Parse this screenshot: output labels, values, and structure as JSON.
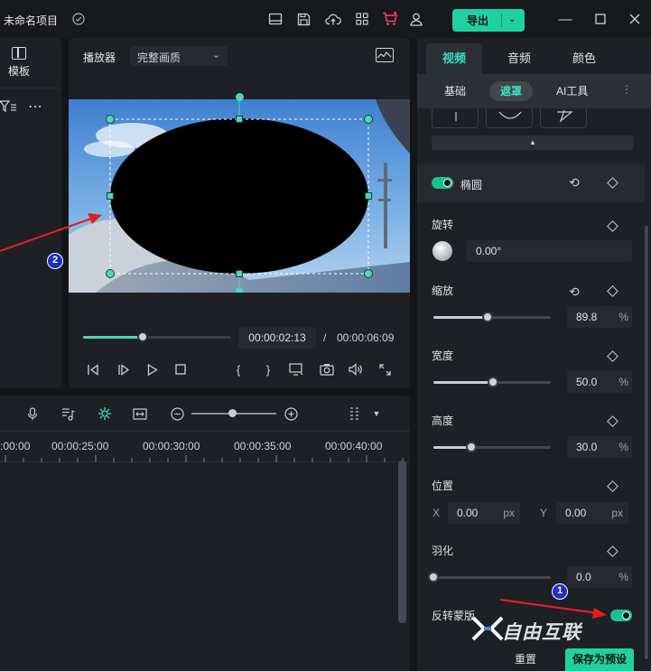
{
  "titlebar": {
    "project_title": "未命名项目",
    "export_label": "导出",
    "accent_color": "#1fd1a1",
    "icons": [
      "check-circle-icon",
      "monitor-icon",
      "save-icon",
      "cloud-upload-icon",
      "apps-grid-icon",
      "cart-icon",
      "user-icon",
      "minimize-icon",
      "maximize-icon",
      "close-icon"
    ]
  },
  "left_panel": {
    "template_tab_label": "模板",
    "filter_icon": "filter-icon",
    "more_icon": "more-icon"
  },
  "player": {
    "label": "播放器",
    "quality": "完整画质",
    "current_time": "00:00:02:13",
    "separator": "/",
    "total_time": "00:00:06:09",
    "progress_fraction": 0.4
  },
  "timeline": {
    "ruler_labels": [
      ":00:00",
      "00:00:25:00",
      "00:00:30:00",
      "00:00:35:00",
      "00:00:40:00"
    ],
    "zoom_fraction": 0.48
  },
  "inspector": {
    "tabs": [
      "视频",
      "音频",
      "颜色"
    ],
    "active_tab": "视频",
    "sub_tabs": [
      "基础",
      "遮罩",
      "AI工具"
    ],
    "active_sub_tab": "遮罩",
    "mask_name": "椭圆",
    "rotation": {
      "label": "旋转",
      "value": "0.00°"
    },
    "scale": {
      "label": "缩放",
      "value": "89.8",
      "unit": "%",
      "fraction": 0.46
    },
    "width": {
      "label": "宽度",
      "value": "50.0",
      "unit": "%",
      "fraction": 0.51
    },
    "height": {
      "label": "高度",
      "value": "30.0",
      "unit": "%",
      "fraction": 0.32
    },
    "position": {
      "label": "位置",
      "x_label": "X",
      "x_value": "0.00",
      "y_label": "Y",
      "y_value": "0.00",
      "unit": "px"
    },
    "feather": {
      "label": "羽化",
      "value": "0.0",
      "unit": "%",
      "fraction": 0.0
    },
    "invert_mask": {
      "label": "反转蒙版",
      "on": true
    },
    "reset_label": "重置",
    "save_preset_label": "保存为预设"
  },
  "annotations": {
    "badge_1": "1",
    "badge_2": "2",
    "arrow_color": "#e02020",
    "watermark": "自由互联"
  }
}
